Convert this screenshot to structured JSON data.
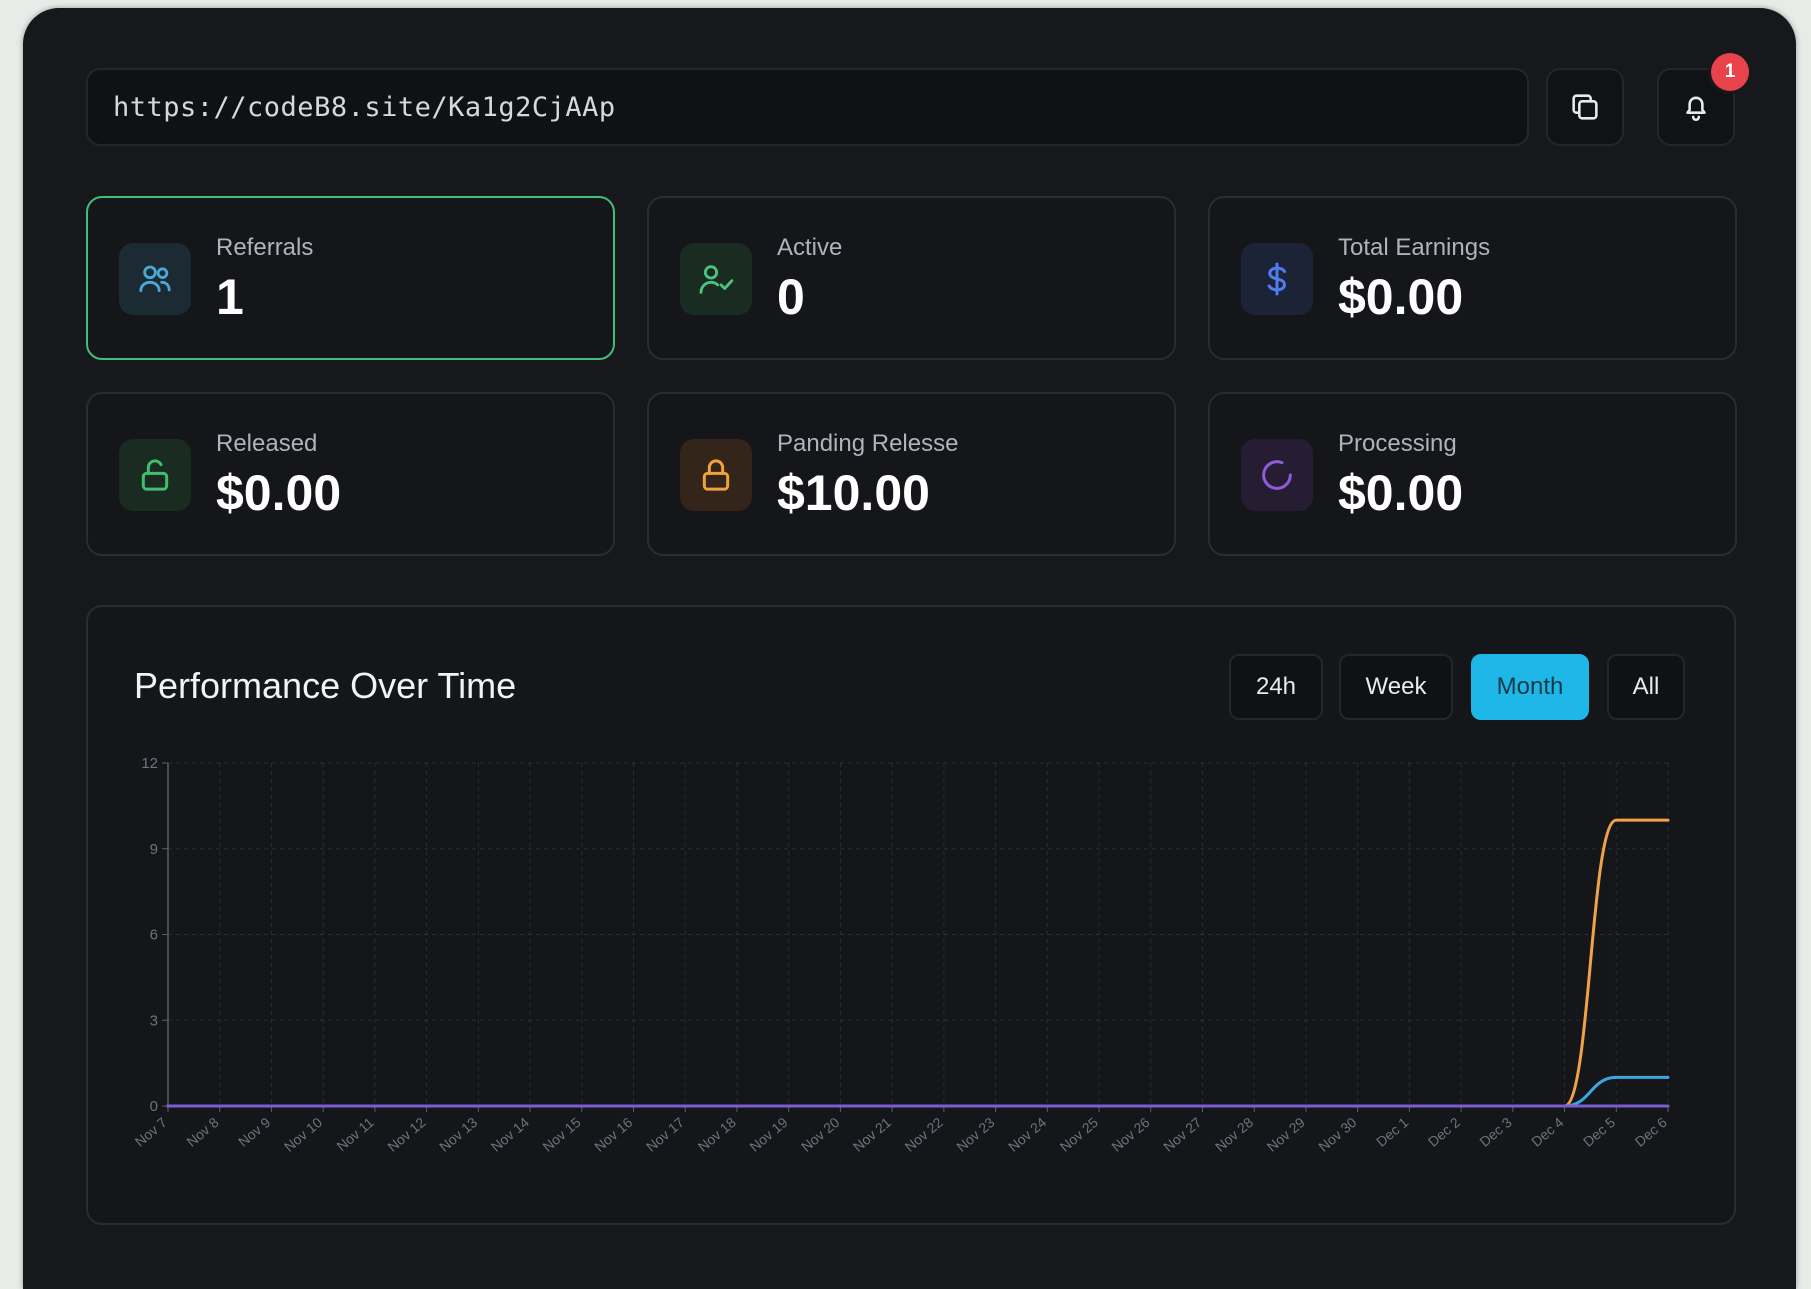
{
  "url_bar": {
    "url": "https://codeB8.site/Ka1g2CjAAp"
  },
  "toolbar": {
    "copy_icon": "copy-icon",
    "bell_icon": "bell-icon",
    "notification_count": "1"
  },
  "stats": [
    {
      "label": "Referrals",
      "value": "1",
      "icon": "users-icon",
      "accent": "#4aa8d8",
      "icon_bg": "#1b2a33"
    },
    {
      "label": "Active",
      "value": "0",
      "icon": "user-check-icon",
      "accent": "#4cc47d",
      "icon_bg": "#1a2c22"
    },
    {
      "label": "Total Earnings",
      "value": "$0.00",
      "icon": "dollar-icon",
      "accent": "#4f7df0",
      "icon_bg": "#1d2336"
    },
    {
      "label": "Released",
      "value": "$0.00",
      "icon": "unlock-icon",
      "accent": "#3fbf6f",
      "icon_bg": "#1a2c22"
    },
    {
      "label": "Panding Relesse",
      "value": "$10.00",
      "icon": "lock-icon",
      "accent": "#f0a33a",
      "icon_bg": "#33251a"
    },
    {
      "label": "Processing",
      "value": "$0.00",
      "icon": "spinner-icon",
      "accent": "#8e5cd9",
      "icon_bg": "#261d33"
    }
  ],
  "performance": {
    "title": "Performance Over Time",
    "ranges": [
      "24h",
      "Week",
      "Month",
      "All"
    ],
    "active_range": "Month"
  },
  "chart_data": {
    "type": "line",
    "title": "Performance Over Time",
    "xlabel": "",
    "ylabel": "",
    "ylim": [
      0,
      12
    ],
    "yticks": [
      0,
      3,
      6,
      9,
      12
    ],
    "grid": true,
    "x": [
      "Nov 7",
      "Nov 8",
      "Nov 9",
      "Nov 10",
      "Nov 11",
      "Nov 12",
      "Nov 13",
      "Nov 14",
      "Nov 15",
      "Nov 16",
      "Nov 17",
      "Nov 18",
      "Nov 19",
      "Nov 20",
      "Nov 21",
      "Nov 22",
      "Nov 23",
      "Nov 24",
      "Nov 25",
      "Nov 26",
      "Nov 27",
      "Nov 28",
      "Nov 29",
      "Nov 30",
      "Dec 1",
      "Dec 2",
      "Dec 3",
      "Dec 4",
      "Dec 5",
      "Dec 6"
    ],
    "series": [
      {
        "color": "#f0a24a",
        "values": [
          0,
          0,
          0,
          0,
          0,
          0,
          0,
          0,
          0,
          0,
          0,
          0,
          0,
          0,
          0,
          0,
          0,
          0,
          0,
          0,
          0,
          0,
          0,
          0,
          0,
          0,
          0,
          0,
          10,
          10
        ]
      },
      {
        "color": "#3aa8e0",
        "values": [
          0,
          0,
          0,
          0,
          0,
          0,
          0,
          0,
          0,
          0,
          0,
          0,
          0,
          0,
          0,
          0,
          0,
          0,
          0,
          0,
          0,
          0,
          0,
          0,
          0,
          0,
          0,
          0,
          1,
          1
        ]
      },
      {
        "color": "#7b5cd6",
        "values": [
          0,
          0,
          0,
          0,
          0,
          0,
          0,
          0,
          0,
          0,
          0,
          0,
          0,
          0,
          0,
          0,
          0,
          0,
          0,
          0,
          0,
          0,
          0,
          0,
          0,
          0,
          0,
          0,
          0,
          0
        ]
      }
    ]
  }
}
